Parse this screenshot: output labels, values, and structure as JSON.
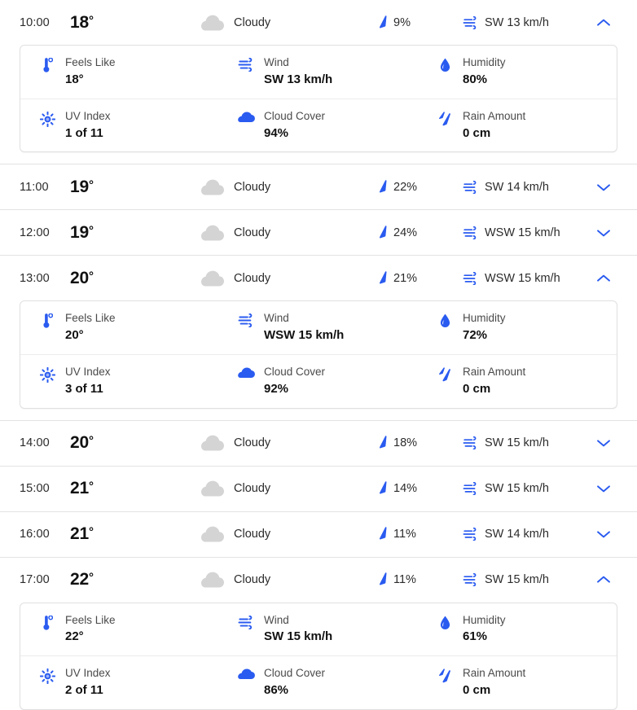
{
  "colors": {
    "accent_blue": "#2a5bf0",
    "cloud_grey": "#d4d4d4",
    "row_border": "#e3e3e3",
    "card_border": "#e0e0e0",
    "text_primary": "#111111",
    "text_secondary": "#4a4a4a"
  },
  "detail_labels": {
    "feels_like": "Feels Like",
    "wind": "Wind",
    "humidity": "Humidity",
    "uv_index": "UV Index",
    "cloud_cover": "Cloud Cover",
    "rain_amount": "Rain Amount"
  },
  "hours": [
    {
      "time": "10:00",
      "temp": "18",
      "degree": "°",
      "condition": "Cloudy",
      "precip_chance": "9%",
      "wind": "SW 13 km/h",
      "expanded": true,
      "chevron": "chevron-up",
      "details": {
        "feels_like": "18°",
        "wind": "SW 13 km/h",
        "humidity": "80%",
        "uv_index": "1 of 11",
        "cloud_cover": "94%",
        "rain_amount": "0 cm"
      }
    },
    {
      "time": "11:00",
      "temp": "19",
      "degree": "°",
      "condition": "Cloudy",
      "precip_chance": "22%",
      "wind": "SW 14 km/h",
      "expanded": false,
      "chevron": "chevron-down",
      "details": null
    },
    {
      "time": "12:00",
      "temp": "19",
      "degree": "°",
      "condition": "Cloudy",
      "precip_chance": "24%",
      "wind": "WSW 15 km/h",
      "expanded": false,
      "chevron": "chevron-down",
      "details": null
    },
    {
      "time": "13:00",
      "temp": "20",
      "degree": "°",
      "condition": "Cloudy",
      "precip_chance": "21%",
      "wind": "WSW 15 km/h",
      "expanded": true,
      "chevron": "chevron-up",
      "details": {
        "feels_like": "20°",
        "wind": "WSW 15 km/h",
        "humidity": "72%",
        "uv_index": "3 of 11",
        "cloud_cover": "92%",
        "rain_amount": "0 cm"
      }
    },
    {
      "time": "14:00",
      "temp": "20",
      "degree": "°",
      "condition": "Cloudy",
      "precip_chance": "18%",
      "wind": "SW 15 km/h",
      "expanded": false,
      "chevron": "chevron-down",
      "details": null
    },
    {
      "time": "15:00",
      "temp": "21",
      "degree": "°",
      "condition": "Cloudy",
      "precip_chance": "14%",
      "wind": "SW 15 km/h",
      "expanded": false,
      "chevron": "chevron-down",
      "details": null
    },
    {
      "time": "16:00",
      "temp": "21",
      "degree": "°",
      "condition": "Cloudy",
      "precip_chance": "11%",
      "wind": "SW 14 km/h",
      "expanded": false,
      "chevron": "chevron-down",
      "details": null
    },
    {
      "time": "17:00",
      "temp": "22",
      "degree": "°",
      "condition": "Cloudy",
      "precip_chance": "11%",
      "wind": "SW 15 km/h",
      "expanded": true,
      "chevron": "chevron-up",
      "details": {
        "feels_like": "22°",
        "wind": "SW 15 km/h",
        "humidity": "61%",
        "uv_index": "2 of 11",
        "cloud_cover": "86%",
        "rain_amount": "0 cm"
      }
    }
  ]
}
